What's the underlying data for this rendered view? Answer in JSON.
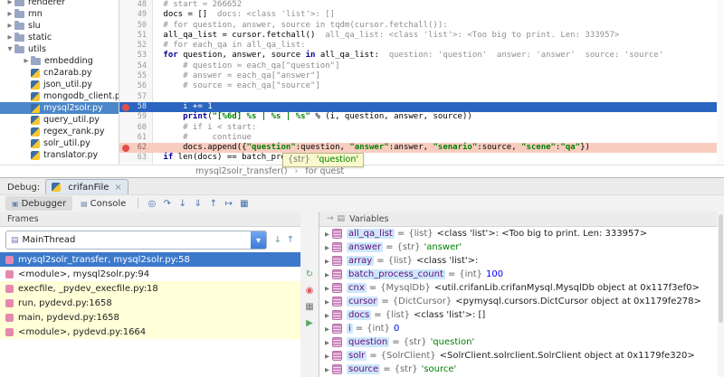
{
  "colors": {
    "execution_line": "#2c65c0",
    "breakpoint_line": "#f8cdc0",
    "breakpoint_dot": "#e2504c",
    "selection_blue": "#3c79cb",
    "library_frame_yellow": "#ffffd8",
    "tree_selection": "#4b86c8",
    "tooltip_yellow": "#f9f9cd"
  },
  "project_tree": {
    "items": [
      {
        "label": "renderer",
        "type": "folder",
        "level": 0,
        "expanded": false
      },
      {
        "label": "rnn",
        "type": "folder",
        "level": 0,
        "expanded": false
      },
      {
        "label": "slu",
        "type": "folder",
        "level": 0,
        "expanded": false
      },
      {
        "label": "static",
        "type": "folder",
        "level": 0,
        "expanded": false
      },
      {
        "label": "utils",
        "type": "folder",
        "level": 0,
        "expanded": true
      },
      {
        "label": "embedding",
        "type": "folder",
        "level": 1,
        "expanded": false
      },
      {
        "label": "cn2arab.py",
        "type": "file",
        "level": 1
      },
      {
        "label": "json_util.py",
        "type": "file",
        "level": 1
      },
      {
        "label": "mongodb_client.py",
        "type": "file",
        "level": 1
      },
      {
        "label": "mysql2solr.py",
        "type": "file",
        "level": 1,
        "selected": true
      },
      {
        "label": "query_util.py",
        "type": "file",
        "level": 1
      },
      {
        "label": "regex_rank.py",
        "type": "file",
        "level": 1
      },
      {
        "label": "solr_util.py",
        "type": "file",
        "level": 1
      },
      {
        "label": "translator.py",
        "type": "file",
        "level": 1
      }
    ]
  },
  "editor": {
    "lines": [
      {
        "n": 48,
        "ind": 1,
        "seg": [
          {
            "s": "com",
            "t": "# start = 266652"
          }
        ]
      },
      {
        "n": 49,
        "ind": 1,
        "seg": [
          {
            "s": "pln",
            "t": "docs = []"
          },
          {
            "s": "dbg",
            "t": "  docs: <class 'list'>: []"
          }
        ]
      },
      {
        "n": 50,
        "ind": 1,
        "seg": [
          {
            "s": "com",
            "t": "# for question, answer, source in tqdm(cursor.fetchall()):"
          }
        ]
      },
      {
        "n": 51,
        "ind": 1,
        "seg": [
          {
            "s": "pln",
            "t": "all_qa_list = cursor.fetchall()"
          },
          {
            "s": "dbg",
            "t": "  all_qa_list: <class 'list'>: <Too big to print. Len: 333957>"
          }
        ]
      },
      {
        "n": 52,
        "ind": 1,
        "seg": [
          {
            "s": "com",
            "t": "# for each_qa in all_qa_list:"
          }
        ]
      },
      {
        "n": 53,
        "ind": 1,
        "seg": [
          {
            "s": "kw",
            "t": "for"
          },
          {
            "s": "pln",
            "t": " question, answer, source "
          },
          {
            "s": "kw",
            "t": "in"
          },
          {
            "s": "pln",
            "t": " all_qa_list:"
          },
          {
            "s": "dbg",
            "t": "  question: 'question'  answer: 'answer'  source: 'source'"
          }
        ]
      },
      {
        "n": 54,
        "ind": 5,
        "seg": [
          {
            "s": "com",
            "t": "# question = each_qa[\"question\"]"
          }
        ]
      },
      {
        "n": 55,
        "ind": 5,
        "seg": [
          {
            "s": "com",
            "t": "# answer = each_qa[\"answer\"]"
          }
        ]
      },
      {
        "n": 56,
        "ind": 5,
        "seg": [
          {
            "s": "com",
            "t": "# source = each_qa[\"source\"]"
          }
        ]
      },
      {
        "n": 57,
        "ind": 0,
        "seg": []
      },
      {
        "n": 58,
        "ind": 5,
        "exec": true,
        "bp": true,
        "seg": [
          {
            "s": "pln",
            "t": "i += "
          },
          {
            "s": "num",
            "t": "1"
          }
        ]
      },
      {
        "n": 59,
        "ind": 5,
        "seg": [
          {
            "s": "kw",
            "t": "print"
          },
          {
            "s": "pln",
            "t": "("
          },
          {
            "s": "str",
            "t": "\"[%6d] %s | %s | %s\""
          },
          {
            "s": "pln",
            "t": " % (i, question, answer, source))"
          }
        ]
      },
      {
        "n": 60,
        "ind": 5,
        "seg": [
          {
            "s": "com",
            "t": "# if i < start:"
          }
        ]
      },
      {
        "n": 61,
        "ind": 5,
        "seg": [
          {
            "s": "com",
            "t": "#     continue"
          }
        ]
      },
      {
        "n": 62,
        "ind": 5,
        "bp": true,
        "seg": [
          {
            "s": "pln",
            "t": "docs.append({"
          },
          {
            "s": "str",
            "t": "\"question\""
          },
          {
            "s": "pln",
            "t": ":question, "
          },
          {
            "s": "str",
            "t": "\"answer\""
          },
          {
            "s": "pln",
            "t": ":answer, "
          },
          {
            "s": "str",
            "t": "\"senario\""
          },
          {
            "s": "pln",
            "t": ":source, "
          },
          {
            "s": "str",
            "t": "\"scene\""
          },
          {
            "s": "pln",
            "t": ":"
          },
          {
            "s": "str",
            "t": "\"qa\""
          },
          {
            "s": "pln",
            "t": "})"
          }
        ]
      },
      {
        "n": 63,
        "ind": 1,
        "seg": [
          {
            "s": "kw",
            "t": "if"
          },
          {
            "s": "pln",
            "t": " len(docs) == batch_process_count:"
          }
        ]
      }
    ]
  },
  "breadcrumb": {
    "function": "mysql2solr_transfer()",
    "separator": "›",
    "context": "for quest"
  },
  "debug": {
    "window_label": "Debug:",
    "session_tab": {
      "label": "crifanFile",
      "close": "×"
    },
    "view_tabs": [
      {
        "label": "Debugger",
        "icon": "▣"
      },
      {
        "label": "Console",
        "icon": "▤"
      }
    ],
    "step_icons": [
      {
        "name": "show-execution-point-icon",
        "glyph": "◎"
      },
      {
        "name": "step-over-icon",
        "glyph": "↷"
      },
      {
        "name": "step-into-icon",
        "glyph": "↓"
      },
      {
        "name": "step-into-my-code-icon",
        "glyph": "⇓"
      },
      {
        "name": "step-out-icon",
        "glyph": "↑"
      },
      {
        "name": "run-to-cursor-icon",
        "glyph": "↦"
      },
      {
        "name": "evaluate-expression-icon",
        "glyph": "▦"
      }
    ],
    "tooltip": {
      "type": "{str}",
      "value": "'question'"
    }
  },
  "frames": {
    "title": "Frames",
    "thread": "MainThread",
    "combo_arrow": "▼",
    "nav_icons": [
      {
        "name": "next-frame-icon",
        "glyph": "↓",
        "color": "#59a869"
      },
      {
        "name": "previous-frame-icon",
        "glyph": "↑",
        "color": "#4a82c8"
      }
    ],
    "rows": [
      {
        "label": "mysql2solr_transfer, mysql2solr.py:58",
        "state": "selected"
      },
      {
        "label": "<module>, mysql2solr.py:94",
        "state": "normal"
      },
      {
        "label": "execfile, _pydev_execfile.py:18",
        "state": "library"
      },
      {
        "label": "run, pydevd.py:1658",
        "state": "library"
      },
      {
        "label": "main, pydevd.py:1658",
        "state": "library"
      },
      {
        "label": "<module>, pydevd.py:1664",
        "state": "library"
      }
    ]
  },
  "side_toolbar": {
    "icons": [
      {
        "name": "rerun-icon",
        "glyph": "↻",
        "color": "#59a869",
        "gap": 62
      },
      {
        "name": "view-breakpoints-icon",
        "glyph": "◉",
        "color": "#db5860",
        "gap": 2
      },
      {
        "name": "restore-layout-icon",
        "glyph": "▦",
        "color": "#777777",
        "gap": 2
      },
      {
        "name": "resume-icon",
        "glyph": "▶",
        "color": "#59a869",
        "gap": 2
      }
    ]
  },
  "variables": {
    "title": "Variables",
    "header_icons": [
      {
        "name": "arrow-icon",
        "glyph": "→"
      },
      {
        "name": "list-view-icon",
        "glyph": "▤"
      }
    ],
    "rows": [
      {
        "name": "all_qa_list",
        "type": "{list}",
        "value": "<class 'list'>: <Too big to print. Len: 333957>"
      },
      {
        "name": "answer",
        "type": "{str}",
        "value": "'answer'",
        "vcls": "str"
      },
      {
        "name": "array",
        "type": "{list}",
        "value": "<class 'list'>: "
      },
      {
        "name": "batch_process_count",
        "type": "{int}",
        "value": "100",
        "vcls": "num"
      },
      {
        "name": "cnx",
        "type": "{MysqlDb}",
        "value": "<util.crifanLib.crifanMysql.MysqlDb object at 0x117f3ef0>"
      },
      {
        "name": "cursor",
        "type": "{DictCursor}",
        "value": "<pymysql.cursors.DictCursor object at 0x1179fe278>"
      },
      {
        "name": "docs",
        "type": "{list}",
        "value": "<class 'list'>: []"
      },
      {
        "name": "i",
        "type": "{int}",
        "value": "0",
        "vcls": "num"
      },
      {
        "name": "question",
        "type": "{str}",
        "value": "'question'",
        "vcls": "str"
      },
      {
        "name": "solr",
        "type": "{SolrClient}",
        "value": "<SolrClient.solrclient.SolrClient object at 0x1179fe320>"
      },
      {
        "name": "source",
        "type": "{str}",
        "value": "'source'",
        "vcls": "str"
      }
    ]
  }
}
